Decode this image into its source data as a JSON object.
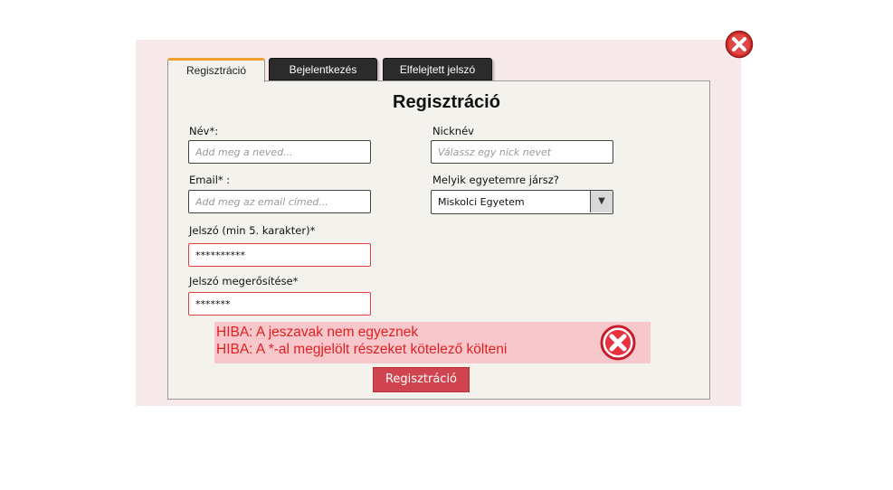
{
  "tabs": {
    "registration": "Regisztráció",
    "login": "Bejelentkezés",
    "forgot": "Elfelejtett jelszó"
  },
  "form": {
    "title": "Regisztráció",
    "name": {
      "label": "Név*:",
      "value": "",
      "placeholder": "Add meg a neved..."
    },
    "nickname": {
      "label": "Nicknév",
      "value": "",
      "placeholder": "Válassz egy nick nevet"
    },
    "email": {
      "label": "Email* :",
      "value": "",
      "placeholder": "Add meg az email címed..."
    },
    "university": {
      "label": "Melyik egyetemre jársz?",
      "selected": "Miskolci Egyetem"
    },
    "password": {
      "label": "Jelszó (min 5. karakter)*",
      "value": "**********"
    },
    "password_confirm": {
      "label": "Jelszó megerősítése*",
      "value": "*******"
    },
    "submit_label": "Regisztráció"
  },
  "errors": {
    "line1": "HIBA: A jeszavak nem egyeznek",
    "line2": "HIBA: A *-al megjelölt részeket kötelező költeni"
  },
  "colors": {
    "error_text": "#e02020",
    "error_bg": "#f8c7cb",
    "submit_bg": "#d0444f",
    "overlay_bg": "#f7e8ea",
    "tab_accent": "#f0a030"
  },
  "icons": {
    "close": "close-circle-icon",
    "error": "error-x-icon"
  }
}
